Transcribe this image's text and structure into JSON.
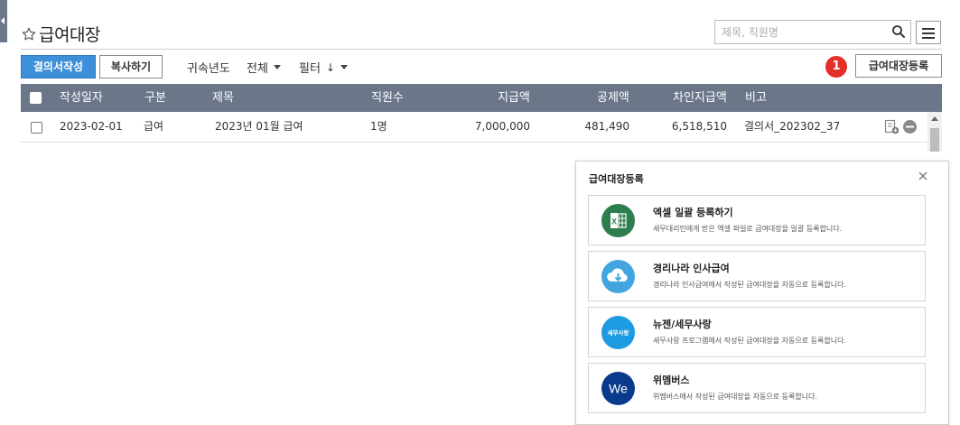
{
  "page": {
    "title": "급여대장"
  },
  "search": {
    "placeholder": "제목, 직원명"
  },
  "toolbar": {
    "write_label": "결의서작성",
    "copy_label": "복사하기",
    "year_label": "귀속년도",
    "all_label": "전체",
    "filter_label": "필터",
    "register_label": "급여대장등록",
    "badge": "1"
  },
  "table": {
    "columns": [
      "작성일자",
      "구분",
      "제목",
      "직원수",
      "지급액",
      "공제액",
      "차인지급액",
      "비고"
    ],
    "rows": [
      {
        "date": "2023-02-01",
        "type": "급여",
        "title": "2023년 01월 급여",
        "employees": "1명",
        "pay": "7,000,000",
        "deduction": "481,490",
        "net": "6,518,510",
        "note": "결의서_202302_37"
      }
    ]
  },
  "panel": {
    "title": "급여대장등록",
    "options": [
      {
        "title": "엑셀 일괄 등록하기",
        "desc": "세무대리인에게 받은 엑셀 파일로 급여대장을 일괄 등록합니다.",
        "icon": "excel-icon",
        "color": "#2e7d4f"
      },
      {
        "title": "경리나라 인사급여",
        "desc": "경리나라 인사급여에서 작성된 급여대장을 자동으로 등록합니다.",
        "icon": "cloud-download-icon",
        "color": "#42a5e0"
      },
      {
        "title": "뉴젠/세무사랑",
        "desc": "세무사랑 프로그램에서 작성된 급여대장을 자동으로 등록합니다.",
        "icon": "semusarang-logo",
        "logo_text": "세무사랑",
        "color": "#1e9be0"
      },
      {
        "title": "위멤버스",
        "desc": "위멤버스에서 작성된 급여대장을 자동으로 등록합니다.",
        "icon": "wemembers-logo",
        "logo_text": "We",
        "color": "#0a3a8c"
      }
    ]
  },
  "colors": {
    "primary": "#3c8fd8",
    "table_header": "#6b7689",
    "badge": "#e4302b"
  }
}
